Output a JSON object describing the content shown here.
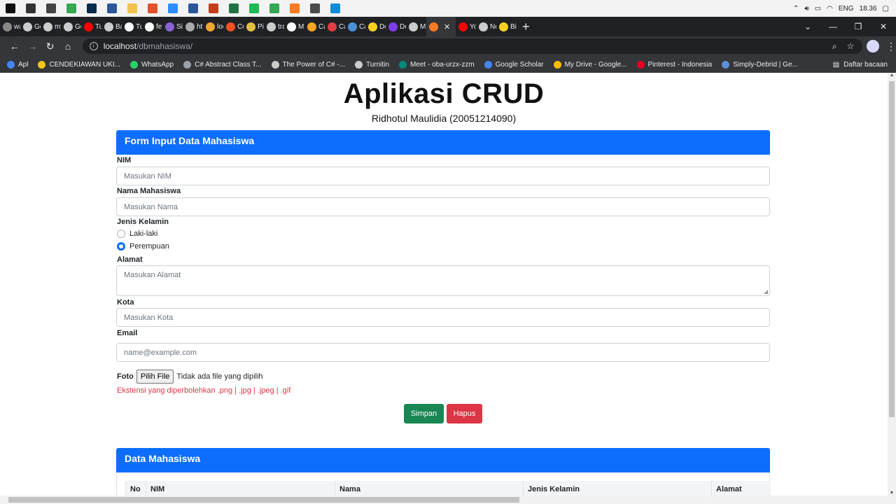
{
  "taskbar": {
    "apps": [
      {
        "name": "start",
        "color": "#111111"
      },
      {
        "name": "search",
        "color": "#333333"
      },
      {
        "name": "task-view",
        "color": "#444444"
      },
      {
        "name": "chrome",
        "color": "#34a853"
      },
      {
        "name": "photoshop",
        "color": "#0b2b4a"
      },
      {
        "name": "word",
        "color": "#2b579a"
      },
      {
        "name": "file-explorer",
        "color": "#f2c14e"
      },
      {
        "name": "powerpoint-orange",
        "color": "#e0522d"
      },
      {
        "name": "zoom",
        "color": "#2d8cff"
      },
      {
        "name": "word-2",
        "color": "#2b579a"
      },
      {
        "name": "powerpoint",
        "color": "#c43e1c"
      },
      {
        "name": "excel",
        "color": "#217346"
      },
      {
        "name": "spotify",
        "color": "#1db954"
      },
      {
        "name": "chrome-2",
        "color": "#34a853"
      },
      {
        "name": "xampp",
        "color": "#fb7a24"
      },
      {
        "name": "sublime",
        "color": "#4b4b4b"
      },
      {
        "name": "edge",
        "color": "#0c8bd6"
      }
    ],
    "language": "ENG",
    "time": "18.36"
  },
  "tabs": [
    {
      "label": "wa",
      "color": "#888888"
    },
    {
      "label": "Gc",
      "color": "#cccccc"
    },
    {
      "label": "my",
      "color": "#cccccc"
    },
    {
      "label": "Gc",
      "color": "#cccccc"
    },
    {
      "label": "Tu",
      "color": "#ff0000"
    },
    {
      "label": "Ba",
      "color": "#cccccc"
    },
    {
      "label": "Tu",
      "color": "#ffffff"
    },
    {
      "label": "fel",
      "color": "#ffffff"
    },
    {
      "label": "Sir",
      "color": "#8a63d2"
    },
    {
      "label": "htt",
      "color": "#aaaaaa"
    },
    {
      "label": "loc",
      "color": "#f0a830"
    },
    {
      "label": "Cc",
      "color": "#f25022"
    },
    {
      "label": "Pic",
      "color": "#e0c040"
    },
    {
      "label": "tra",
      "color": "#cccccc"
    },
    {
      "label": "M",
      "color": "#ffffff"
    },
    {
      "label": "Ca",
      "color": "#f5a623"
    },
    {
      "label": "Ca",
      "color": "#e04040"
    },
    {
      "label": "Ca",
      "color": "#4a90d9"
    },
    {
      "label": "Dc",
      "color": "#f5d020"
    },
    {
      "label": "Dc",
      "color": "#7b3fe4"
    },
    {
      "label": "M",
      "color": "#cccccc"
    },
    {
      "label": "",
      "color": "#fb7a24",
      "active": true,
      "close": "✕"
    },
    {
      "label": "Yo",
      "color": "#ff0000"
    },
    {
      "label": "Ne",
      "color": "#cccccc"
    },
    {
      "label": "Bi",
      "color": "#f5d020"
    }
  ],
  "new_tab": "+",
  "window_controls": {
    "minimize": "—",
    "restore": "❐",
    "close": "✕"
  },
  "address": {
    "host": "localhost",
    "path": "/dbmahasiswa/"
  },
  "bookmarks": [
    {
      "label": "Apl",
      "color": "#4285f4"
    },
    {
      "label": "CENDEKIAWAN UKI...",
      "color": "#f5c518"
    },
    {
      "label": "WhatsApp",
      "color": "#25d366"
    },
    {
      "label": "C# Abstract Class T...",
      "color": "#9aa0a6"
    },
    {
      "label": "The Power of C# -...",
      "color": "#cccccc"
    },
    {
      "label": "Turnitin",
      "color": "#cccccc"
    },
    {
      "label": "Meet - oba-urzx-zzm",
      "color": "#00897b"
    },
    {
      "label": "Google Scholar",
      "color": "#4285f4"
    },
    {
      "label": "My Drive - Google...",
      "color": "#fbbc04"
    },
    {
      "label": "Pinterest - Indonesia",
      "color": "#e60023"
    },
    {
      "label": "Simply-Debrid | Ge...",
      "color": "#5b8dd9"
    }
  ],
  "reading_list": "Daftar bacaan",
  "page": {
    "title": "Aplikasi CRUD",
    "subtitle": "Ridhotul Maulidia (20051214090)",
    "form": {
      "header": "Form Input Data Mahasiswa",
      "nim_label": "NIM",
      "nim_placeholder": "Masukan NIM",
      "nama_label": "Nama Mahasiswa",
      "nama_placeholder": "Masukan Nama",
      "gender_label": "Jenis Kelamin",
      "gender_options": [
        {
          "label": "Laki-laki",
          "selected": false
        },
        {
          "label": "Perempuan",
          "selected": true
        }
      ],
      "alamat_label": "Alamat",
      "alamat_placeholder": "Masukan Alamat",
      "kota_label": "Kota",
      "kota_placeholder": "Masukan Kota",
      "email_label": "Email",
      "email_placeholder": "name@example.com",
      "foto_label": "Foto",
      "file_button": "Pilih File",
      "file_status": "Tidak ada file yang dipilih",
      "ext_hint": "Ekstensi yang diperbolehkan .png | .jpg | .jpeg | .gif",
      "save_button": "Simpan",
      "delete_button": "Hapus"
    },
    "table": {
      "header": "Data Mahasiswa",
      "columns": [
        "No",
        "NIM",
        "Nama",
        "Jenis Kelamin",
        "Alamat"
      ]
    }
  },
  "colors": {
    "primary": "#0d6efd",
    "success": "#198754",
    "danger": "#dc3545"
  }
}
